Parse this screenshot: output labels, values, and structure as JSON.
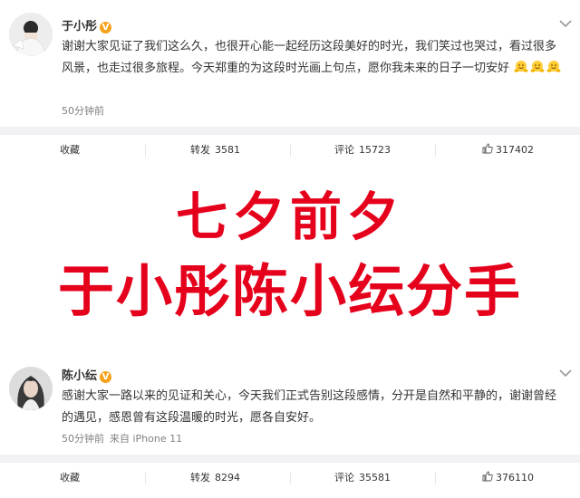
{
  "post_top": {
    "username": "于小彤",
    "verified_mark": "V",
    "content_text": "谢谢大家见证了我们这么久，也很开心能一起经历这段美好的时光，我们笑过也哭过，看过很多风景，也走过很多旅程。今天郑重的为这段时光画上句点，愿你我未来的日子一切安好",
    "emoji_icon": "hugging-emoji",
    "time": "50分钟前",
    "actions": {
      "favorite_label": "收藏",
      "forward_label": "转发",
      "forward_count": "3581",
      "comment_label": "评论",
      "comment_count": "15723",
      "like_count": "317402"
    }
  },
  "headline": {
    "line1": "七夕前夕",
    "line2": "于小彤陈小纭分手",
    "color": "#e5001b"
  },
  "post_bottom": {
    "username": "陈小纭",
    "verified_mark": "V",
    "content_text": "感谢大家一路以来的见证和关心，今天我们正式告别这段感情，分开是自然和平静的，谢谢曾经的遇见，感恩曾有这段温暖的时光，愿各自安好。",
    "time": "50分钟前",
    "source": "来自 iPhone 11",
    "actions": {
      "favorite_label": "收藏",
      "forward_label": "转发",
      "forward_count": "8294",
      "comment_label": "评论",
      "comment_count": "35581",
      "like_count": "376110"
    }
  },
  "colors": {
    "verified_badge": "#f7a21c",
    "meta_text": "#808080",
    "divider": "#f2f2f5"
  }
}
